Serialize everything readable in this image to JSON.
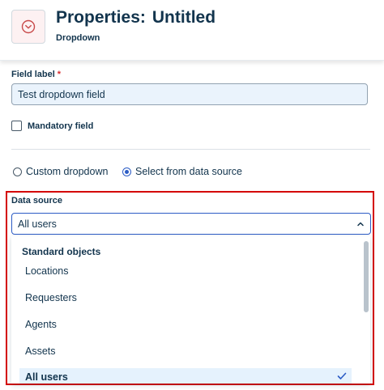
{
  "header": {
    "title_prefix": "Properties:",
    "title_name": "Untitled",
    "subtitle": "Dropdown",
    "icon": "dropdown-chevron-circle-icon"
  },
  "form": {
    "field_label": {
      "label": "Field label",
      "required_marker": "*",
      "value": "Test dropdown field"
    },
    "mandatory": {
      "label": "Mandatory field",
      "checked": false
    },
    "source_options": [
      {
        "label": "Custom dropdown",
        "selected": false
      },
      {
        "label": "Select from data source",
        "selected": true
      }
    ],
    "data_source": {
      "label": "Data source",
      "value": "All users",
      "menu": {
        "group_label": "Standard objects",
        "items": [
          {
            "label": "Locations",
            "selected": false
          },
          {
            "label": "Requesters",
            "selected": false
          },
          {
            "label": "Agents",
            "selected": false
          },
          {
            "label": "Assets",
            "selected": false
          },
          {
            "label": "All users",
            "selected": true
          }
        ]
      }
    }
  },
  "colors": {
    "accent": "#2c5cc5",
    "highlight_border": "#d40000",
    "required": "#d72d30",
    "input_fill": "#eaf3fc",
    "selected_item": "#e5f2fd"
  }
}
